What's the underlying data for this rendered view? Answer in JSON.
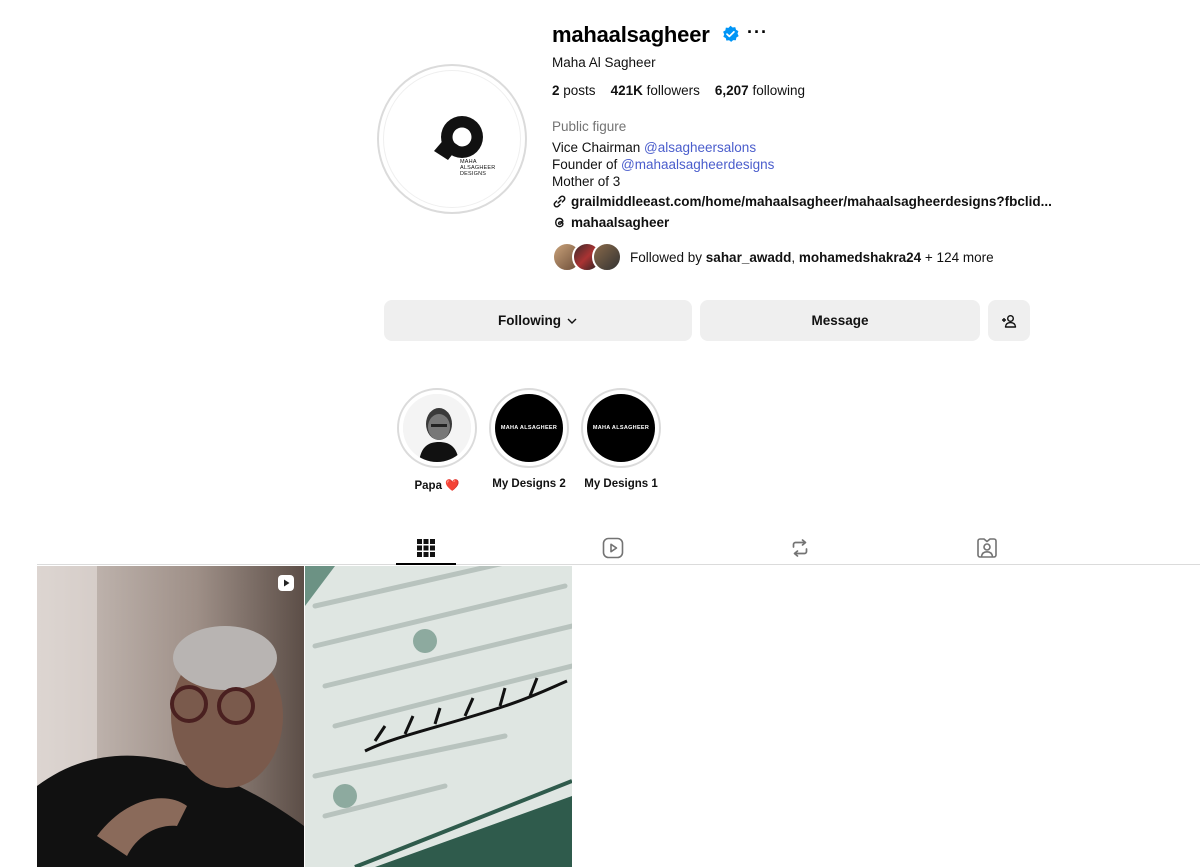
{
  "profile": {
    "username": "mahaalsagheer",
    "full_name": "Maha Al Sagheer",
    "more_label": "···",
    "logo_line1": "MAHA",
    "logo_line2": "ALSAGHEER",
    "logo_line3": "DESIGNS"
  },
  "stats": {
    "posts_count": "2",
    "posts_label": "posts",
    "followers_count": "421K",
    "followers_label": "followers",
    "following_count": "6,207",
    "following_label": "following"
  },
  "bio": {
    "category": "Public figure",
    "line1_prefix": "Vice Chairman ",
    "line1_mention": "@alsagheersalons",
    "line2_prefix": "Founder of ",
    "line2_mention": "@mahaalsagheerdesigns",
    "line3": "Mother of 3",
    "link": "grailmiddleeast.com/home/mahaalsagheer/mahaalsagheerdesigns?fbclid...",
    "threads_handle": "mahaalsagheer"
  },
  "followed_by": {
    "prefix": "Followed by ",
    "user1": "sahar_awadd",
    "sep": ", ",
    "user2": "mohamedshakra24",
    "suffix": " + 124 more"
  },
  "actions": {
    "following_label": "Following",
    "message_label": "Message"
  },
  "highlights": [
    {
      "label": "Papa ❤️",
      "cover_text": ""
    },
    {
      "label": "My Designs 2",
      "cover_text": "MAHA ALSAGHEER"
    },
    {
      "label": "My Designs 1",
      "cover_text": "MAHA ALSAGHEER"
    }
  ],
  "tabs": [
    {
      "icon": "grid-icon",
      "active": true
    },
    {
      "icon": "reels-icon",
      "active": false
    },
    {
      "icon": "reposts-icon",
      "active": false
    },
    {
      "icon": "tagged-icon",
      "active": false
    }
  ],
  "posts": [
    {
      "type": "reel",
      "icon": "reel-badge-icon"
    },
    {
      "type": "image"
    }
  ],
  "colors": {
    "link_blue": "#4a5dcc",
    "verified_blue": "#0095f6",
    "button_bg": "#efefef",
    "muted_text": "#737373",
    "border": "#dbdbdb"
  }
}
